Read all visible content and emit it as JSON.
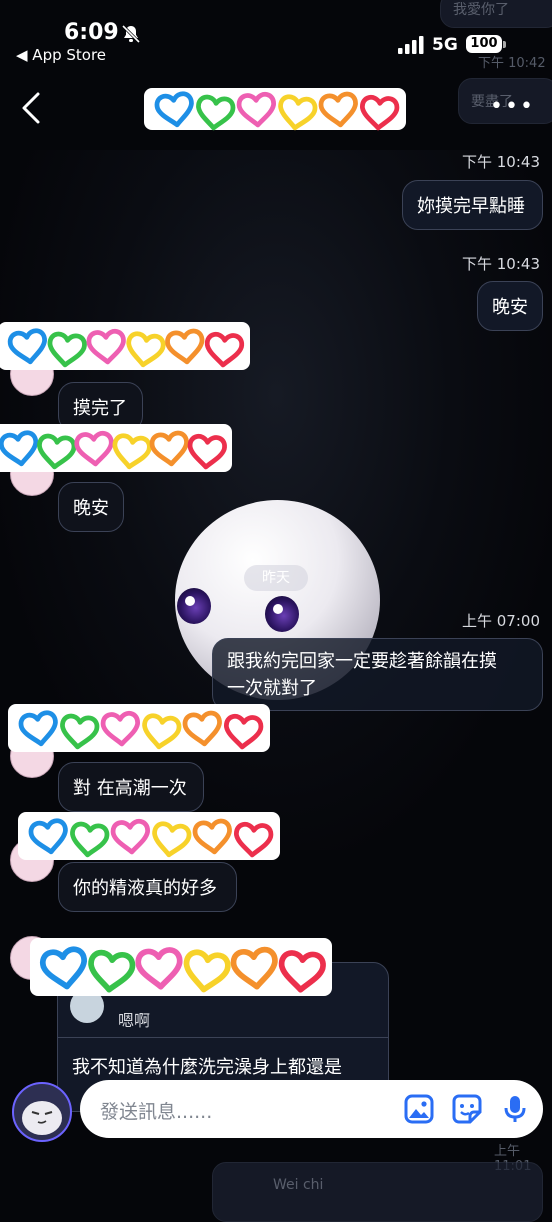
{
  "status_bar": {
    "time": "6:09",
    "back_app": "◀ App Store",
    "network": "5G",
    "battery": "100"
  },
  "header": {
    "more": "•••"
  },
  "messages": [
    {
      "time": "下午 10:43",
      "text": "妳摸完早點睡"
    },
    {
      "time": "下午 10:43",
      "text": "晚安"
    },
    {
      "text": "摸完了"
    },
    {
      "text": "晚安"
    },
    {
      "day_label": "昨天"
    },
    {
      "time": "上午 07:00",
      "text_line1": "跟我約完回家一定要趁著餘韻在摸",
      "text_line2": "一次就對了"
    },
    {
      "text": "對 在高潮一次"
    },
    {
      "text": "你的精液真的好多"
    },
    {
      "reply_quote": "嗯啊",
      "text": "我不知道為什麼洗完澡身上都還是"
    }
  ],
  "ghosts": {
    "top_right_1": "我愛你了",
    "top_right_time": "下午 10:42",
    "top_right_2": "要盡了",
    "bottom_time": "上午 11:01",
    "bottom_name": "Wei chi"
  },
  "input": {
    "placeholder": "發送訊息......"
  },
  "colors": {
    "heart_blue": "#1e8fe6",
    "heart_green": "#37c24a",
    "heart_pink": "#ee5fb2",
    "heart_yellow": "#f7d22a",
    "heart_orange": "#f4902c",
    "heart_red": "#ec2f4c",
    "accent": "#2a6df4"
  }
}
